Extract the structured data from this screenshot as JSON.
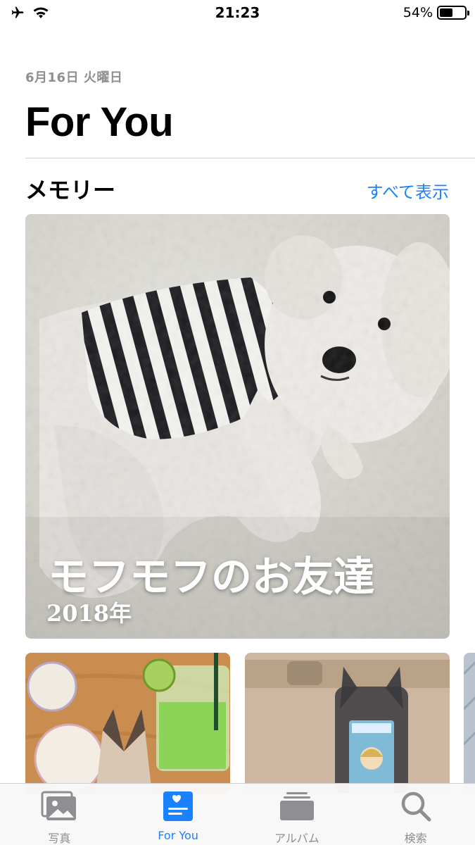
{
  "status_bar": {
    "time": "21:23",
    "battery_percent": "54%",
    "battery_level": 0.54,
    "icons": [
      "airplane-icon",
      "wifi-icon",
      "battery-icon"
    ]
  },
  "header": {
    "date": "6月16日 火曜日",
    "title": "For You"
  },
  "memories": {
    "section_title": "メモリー",
    "see_all_label": "すべて表示",
    "featured": {
      "title": "モフモフのお友達",
      "year": "2018年"
    }
  },
  "tab_bar": {
    "tabs": [
      {
        "label": "写真",
        "icon": "photos-icon",
        "active": false
      },
      {
        "label": "For You",
        "icon": "for-you-icon",
        "active": true
      },
      {
        "label": "アルバム",
        "icon": "albums-icon",
        "active": false
      },
      {
        "label": "検索",
        "icon": "search-icon",
        "active": false
      }
    ]
  },
  "colors": {
    "accent": "#1a82ff",
    "inactive": "#8e8e93",
    "secondary_text": "#8e8e93"
  }
}
